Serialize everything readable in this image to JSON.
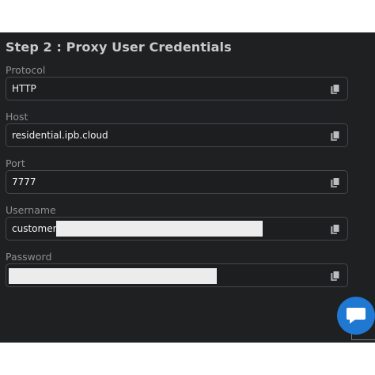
{
  "panel": {
    "title": "Step 2 : Proxy User Credentials"
  },
  "fields": {
    "protocol": {
      "label": "Protocol",
      "value": "HTTP"
    },
    "host": {
      "label": "Host",
      "value": "residential.ipb.cloud"
    },
    "port": {
      "label": "Port",
      "value": "7777"
    },
    "username": {
      "label": "Username",
      "value": "customer-r"
    },
    "password": {
      "label": "Password",
      "value": ""
    }
  },
  "icons": {
    "copy": "copy-icon",
    "chat": "chat-bubble-icon"
  },
  "colors": {
    "panel_background": "#1f2022",
    "field_border": "#46474b",
    "chat_button": "#1f78d1"
  }
}
